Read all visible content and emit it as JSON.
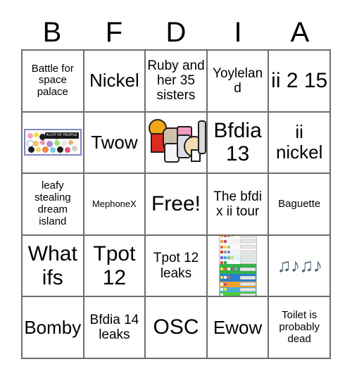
{
  "card": {
    "title_letters": [
      "B",
      "F",
      "D",
      "I",
      "A"
    ],
    "rows": [
      [
        {
          "type": "text",
          "text": "Battle for space palace",
          "size": "sm"
        },
        {
          "type": "text",
          "text": "Nickel",
          "size": "lg"
        },
        {
          "type": "text",
          "text": "Ruby and her 35 sisters",
          "size": "md"
        },
        {
          "type": "text",
          "text": "Yoyleland",
          "size": "md"
        },
        {
          "type": "text",
          "text": "ii 2 15",
          "size": "xl"
        }
      ],
      [
        {
          "type": "image",
          "image": "a-lot-of-people-thumbnail",
          "alt_label": "A LOT OF PEOPLE"
        },
        {
          "type": "text",
          "text": "Twow",
          "size": "lg"
        },
        {
          "type": "image",
          "image": "cartoon-characters-thumbnail",
          "alt_label": "cartoon characters group"
        },
        {
          "type": "text",
          "text": "Bfdia 13",
          "size": "xl"
        },
        {
          "type": "text",
          "text": "ii nickel",
          "size": "lg"
        }
      ],
      [
        {
          "type": "text",
          "text": "leafy stealing dream island",
          "size": "sm"
        },
        {
          "type": "text",
          "text": "MephoneX",
          "size": "xs"
        },
        {
          "type": "text",
          "text": "Free!",
          "size": "xl"
        },
        {
          "type": "text",
          "text": "The bfdi x ii tour",
          "size": "md"
        },
        {
          "type": "text",
          "text": "Baguette",
          "size": "sm"
        }
      ],
      [
        {
          "type": "text",
          "text": "What ifs",
          "size": "xl"
        },
        {
          "type": "text",
          "text": "Tpot 12",
          "size": "xl"
        },
        {
          "type": "text",
          "text": "Tpot 12 leaks",
          "size": "md"
        },
        {
          "type": "image",
          "image": "tier-list-thumbnail",
          "alt_label": "colorful tier list"
        },
        {
          "type": "emoji",
          "text": "♫♪♫♪",
          "emoji_name": "music-notes"
        }
      ],
      [
        {
          "type": "text",
          "text": "Bomby",
          "size": "lg"
        },
        {
          "type": "text",
          "text": "Bfdia 14 leaks",
          "size": "md"
        },
        {
          "type": "text",
          "text": "OSC",
          "size": "xl"
        },
        {
          "type": "text",
          "text": "Ewow",
          "size": "lg"
        },
        {
          "type": "text",
          "text": "Toilet is probably dead",
          "size": "sm"
        }
      ]
    ],
    "colors": {
      "grid_line": "#6e6e6e",
      "text": "#000000",
      "background": "#ffffff",
      "music_note": "#4d6272",
      "thumb_border": "#8187c4"
    }
  }
}
